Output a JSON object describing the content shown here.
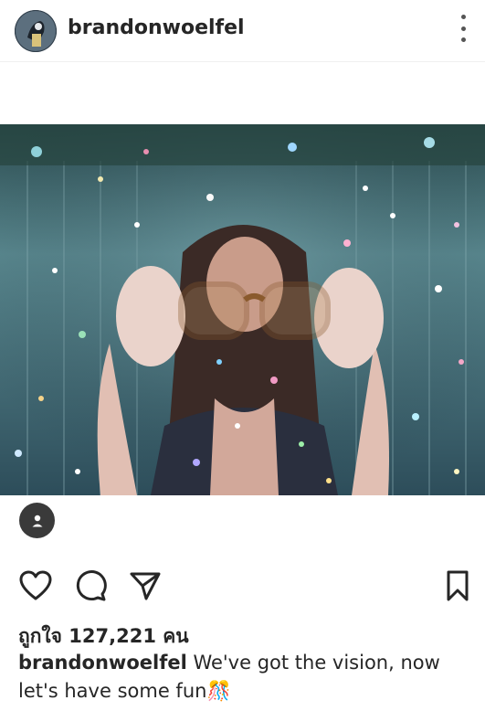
{
  "post": {
    "username": "brandonwoelfel",
    "likes_text": "ถูกใจ 127,221 คน",
    "caption": {
      "username": "brandonwoelfel",
      "text": " We've got the vision, now let's have some fun",
      "emoji": "🎊"
    },
    "icons": {
      "more": "more-vertical-icon",
      "tag": "person-tag-icon",
      "like": "heart-icon",
      "comment": "comment-icon",
      "share": "send-icon",
      "save": "bookmark-icon"
    }
  }
}
